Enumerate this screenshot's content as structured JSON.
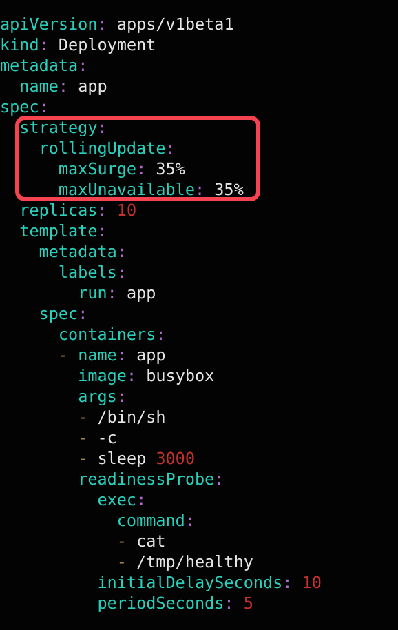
{
  "editor": {
    "background_color": "#030303",
    "language": "yaml",
    "title": "Kubernetes Deployment manifest"
  },
  "theme": {
    "key_color": "#29d1bd",
    "colon_color": "#b06ad1",
    "value_color": "#e6e6e6",
    "number_color": "#c5312c",
    "dash_color": "#a8854a",
    "highlight_color": "#f5444f"
  },
  "annotation": {
    "type": "rounded-rectangle-highlight",
    "color": "#f5444f",
    "covers_lines": [
      6,
      7,
      8,
      9
    ],
    "covers_text": "strategy: rollingUpdate: maxSurge: 35% maxUnavailable: 35%"
  },
  "code": {
    "lines": [
      {
        "indent": 0,
        "key": "apiVersion",
        "colon": ":",
        "value": "apps/v1beta1",
        "value_type": "string"
      },
      {
        "indent": 0,
        "key": "kind",
        "colon": ":",
        "value": "Deployment",
        "value_type": "string"
      },
      {
        "indent": 0,
        "key": "metadata",
        "colon": ":",
        "value": "",
        "value_type": "none"
      },
      {
        "indent": 2,
        "key": "name",
        "colon": ":",
        "value": "app",
        "value_type": "string"
      },
      {
        "indent": 0,
        "key": "spec",
        "colon": ":",
        "value": "",
        "value_type": "none"
      },
      {
        "indent": 2,
        "key": "strategy",
        "colon": ":",
        "value": "",
        "value_type": "none"
      },
      {
        "indent": 4,
        "key": "rollingUpdate",
        "colon": ":",
        "value": "",
        "value_type": "none"
      },
      {
        "indent": 6,
        "key": "maxSurge",
        "colon": ":",
        "value": "35%",
        "value_type": "string"
      },
      {
        "indent": 6,
        "key": "maxUnavailable",
        "colon": ":",
        "value": "35%",
        "value_type": "string"
      },
      {
        "indent": 2,
        "key": "replicas",
        "colon": ":",
        "value": "10",
        "value_type": "number"
      },
      {
        "indent": 2,
        "key": "template",
        "colon": ":",
        "value": "",
        "value_type": "none"
      },
      {
        "indent": 4,
        "key": "metadata",
        "colon": ":",
        "value": "",
        "value_type": "none"
      },
      {
        "indent": 6,
        "key": "labels",
        "colon": ":",
        "value": "",
        "value_type": "none"
      },
      {
        "indent": 8,
        "key": "run",
        "colon": ":",
        "value": "app",
        "value_type": "string"
      },
      {
        "indent": 4,
        "key": "spec",
        "colon": ":",
        "value": "",
        "value_type": "none"
      },
      {
        "indent": 6,
        "key": "containers",
        "colon": ":",
        "value": "",
        "value_type": "none"
      },
      {
        "indent": 6,
        "dash": "-",
        "key": "name",
        "colon": ":",
        "value": "app",
        "value_type": "string"
      },
      {
        "indent": 8,
        "key": "image",
        "colon": ":",
        "value": "busybox",
        "value_type": "string"
      },
      {
        "indent": 8,
        "key": "args",
        "colon": ":",
        "value": "",
        "value_type": "none"
      },
      {
        "indent": 8,
        "dash": "-",
        "value": "/bin/sh",
        "value_type": "string"
      },
      {
        "indent": 8,
        "dash": "-",
        "value": "-c",
        "value_type": "string"
      },
      {
        "indent": 8,
        "dash": "-",
        "value": "sleep ",
        "number": "3000",
        "value_type": "mixed"
      },
      {
        "indent": 8,
        "key": "readinessProbe",
        "colon": ":",
        "value": "",
        "value_type": "none"
      },
      {
        "indent": 10,
        "key": "exec",
        "colon": ":",
        "value": "",
        "value_type": "none"
      },
      {
        "indent": 12,
        "key": "command",
        "colon": ":",
        "value": "",
        "value_type": "none"
      },
      {
        "indent": 12,
        "dash": "-",
        "value": "cat",
        "value_type": "string"
      },
      {
        "indent": 12,
        "dash": "-",
        "value": "/tmp/healthy",
        "value_type": "string"
      },
      {
        "indent": 10,
        "key": "initialDelaySeconds",
        "colon": ":",
        "value": "10",
        "value_type": "number"
      },
      {
        "indent": 10,
        "key": "periodSeconds",
        "colon": ":",
        "value": "5",
        "value_type": "number"
      }
    ]
  }
}
